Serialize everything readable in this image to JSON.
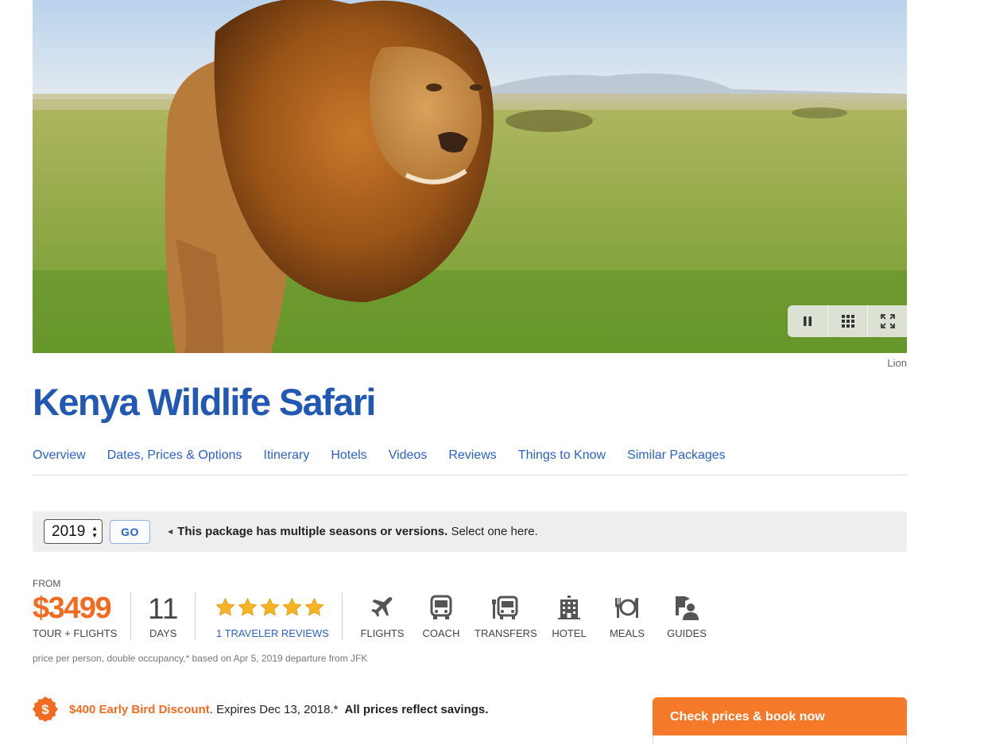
{
  "hero": {
    "caption": "Lion",
    "controls": {
      "pause_icon": "pause-icon",
      "grid_icon": "grid-icon",
      "fullscreen_icon": "fullscreen-icon"
    }
  },
  "package": {
    "title": "Kenya Wildlife Safari"
  },
  "tabs": [
    {
      "label": "Overview"
    },
    {
      "label": "Dates, Prices & Options"
    },
    {
      "label": "Itinerary"
    },
    {
      "label": "Hotels"
    },
    {
      "label": "Videos"
    },
    {
      "label": "Reviews"
    },
    {
      "label": "Things to Know"
    },
    {
      "label": "Similar Packages"
    }
  ],
  "season": {
    "year": "2019",
    "go_label": "GO",
    "message_bold": "This package has multiple seasons or versions.",
    "message_rest": " Select one here."
  },
  "summary": {
    "from_label": "FROM",
    "price": "$3499",
    "price_sub": "TOUR + FLIGHTS",
    "days": "11",
    "days_label": "DAYS",
    "rating": 5,
    "reviews_link": "1 TRAVELER REVIEWS",
    "inclusions": [
      {
        "label": "FLIGHTS",
        "icon": "plane-icon"
      },
      {
        "label": "COACH",
        "icon": "bus-icon"
      },
      {
        "label": "TRANSFERS",
        "icon": "transfer-bus-icon"
      },
      {
        "label": "HOTEL",
        "icon": "hotel-icon"
      },
      {
        "label": "MEALS",
        "icon": "meals-icon"
      },
      {
        "label": "GUIDES",
        "icon": "guides-icon"
      }
    ],
    "note": "price per person, double occupancy,* based on Apr 5, 2019 departure from JFK"
  },
  "discount": {
    "highlight": "$400 Early Bird Discount",
    "expires": ". Expires Dec 13, 2018.*",
    "savings": "All prices reflect savings."
  },
  "booking": {
    "button_label": "Check prices & book now"
  },
  "colors": {
    "brand_blue": "#2158b3",
    "accent_orange": "#f26b21",
    "button_orange": "#f47a2a"
  }
}
